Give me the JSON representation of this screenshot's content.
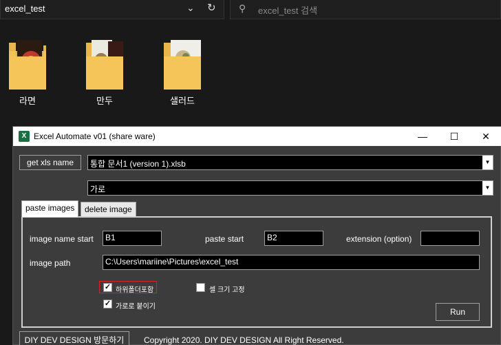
{
  "explorer": {
    "address": "excel_test",
    "search_placeholder": "excel_test 검색",
    "folders": [
      {
        "label": "라면"
      },
      {
        "label": "만두"
      },
      {
        "label": "샐러드"
      }
    ]
  },
  "window": {
    "title": "Excel Automate v01 (share ware)",
    "app_icon": "X",
    "get_xls_label": "get xls name",
    "file_combo_value": "통합 문서1 (version 1).xlsb",
    "orientation_combo_value": "가로",
    "tabs": [
      {
        "label": "paste images",
        "active": true
      },
      {
        "label": "delete image",
        "active": false
      }
    ],
    "form": {
      "image_name_start_label": "image name start",
      "image_name_start_value": "B1",
      "paste_start_label": "paste start",
      "paste_start_value": "B2",
      "extension_label": "extension (option)",
      "extension_value": "",
      "image_path_label": "image path",
      "image_path_value": "C:\\Users\\mariine\\Pictures\\excel_test",
      "include_subfolder_label": "하위폴더포함",
      "include_subfolder_checked": true,
      "fix_cell_size_label": "셀 크기 고정",
      "fix_cell_size_checked": false,
      "paste_horizontal_label": "가로로 붙이기",
      "paste_horizontal_checked": true,
      "run_label": "Run"
    },
    "visit_button_label": "DIY DEV DESIGN 방문하기",
    "copyright": "Copyright 2020. DIY DEV DESIGN All Right Reserved."
  }
}
